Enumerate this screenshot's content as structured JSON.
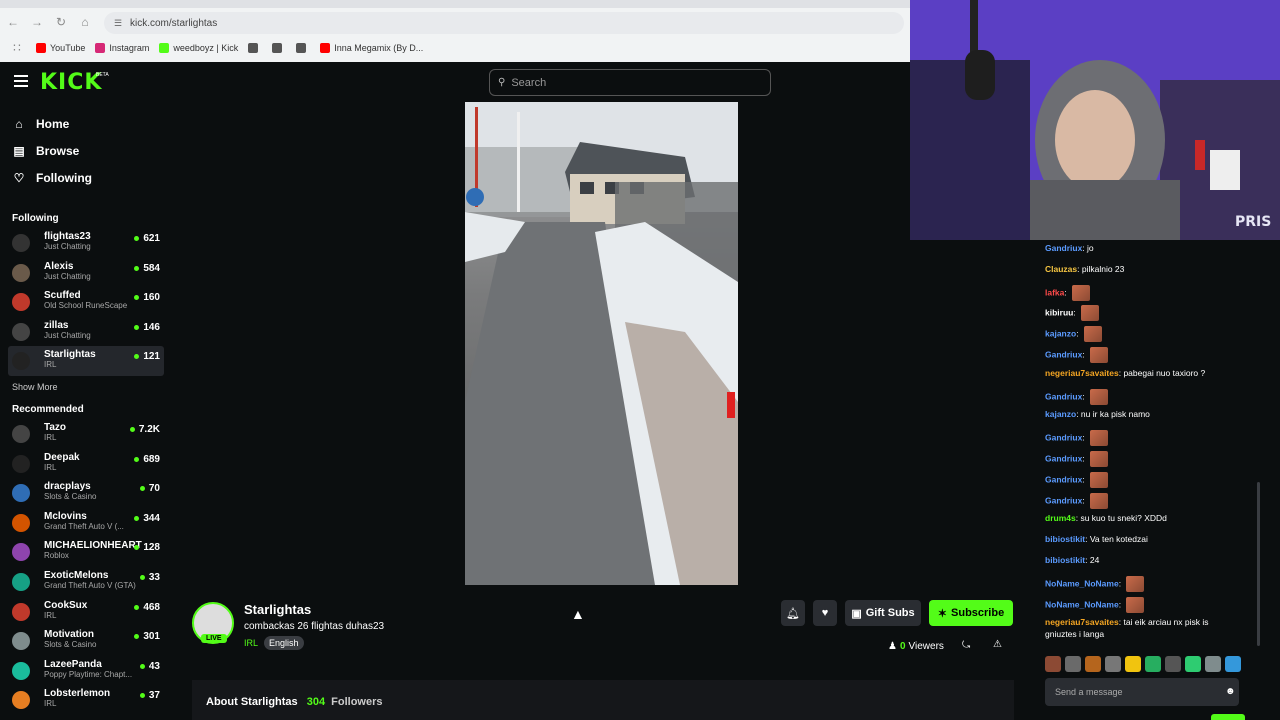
{
  "browser": {
    "url": "kick.com/starlightas",
    "bookmarks": [
      {
        "label": "YouTube",
        "color": "#ff0000"
      },
      {
        "label": "Instagram",
        "color": "#d62976"
      },
      {
        "label": "weedboyz | Kick",
        "color": "#53fc18"
      },
      {
        "label": "",
        "color": "#555555"
      },
      {
        "label": "",
        "color": "#555555"
      },
      {
        "label": "",
        "color": "#555555"
      },
      {
        "label": "Inna Megamix (By D...",
        "color": "#ff0000"
      }
    ]
  },
  "header": {
    "logo": "KICK",
    "logo_badge": "BETA",
    "search_placeholder": "Search"
  },
  "sidebar": {
    "nav": [
      {
        "label": "Home",
        "icon": "home-icon"
      },
      {
        "label": "Browse",
        "icon": "browse-icon"
      },
      {
        "label": "Following",
        "icon": "heart-icon"
      }
    ],
    "following_title": "Following",
    "following": [
      {
        "name": "flightas23",
        "category": "Just Chatting",
        "viewers": "621"
      },
      {
        "name": "Alexis",
        "category": "Just Chatting",
        "viewers": "584"
      },
      {
        "name": "Scuffed",
        "category": "Old School RuneScape",
        "viewers": "160"
      },
      {
        "name": "zillas",
        "category": "Just Chatting",
        "viewers": "146"
      },
      {
        "name": "Starlightas",
        "category": "IRL",
        "viewers": "121"
      }
    ],
    "show_more": "Show More",
    "recommended_title": "Recommended",
    "recommended": [
      {
        "name": "Tazo",
        "category": "IRL",
        "viewers": "7.2K"
      },
      {
        "name": "Deepak",
        "category": "IRL",
        "viewers": "689"
      },
      {
        "name": "dracplays",
        "category": "Slots & Casino",
        "viewers": "70"
      },
      {
        "name": "Mclovins",
        "category": "Grand Theft Auto V (...",
        "viewers": "344"
      },
      {
        "name": "MICHAELIONHEART",
        "category": "Roblox",
        "viewers": "128"
      },
      {
        "name": "ExoticMelons",
        "category": "Grand Theft Auto V (GTA)",
        "viewers": "33"
      },
      {
        "name": "CookSux",
        "category": "IRL",
        "viewers": "468"
      },
      {
        "name": "Motivation",
        "category": "Slots & Casino",
        "viewers": "301"
      },
      {
        "name": "LazeePanda",
        "category": "Poppy Playtime: Chapt...",
        "viewers": "43"
      },
      {
        "name": "Lobsterlemon",
        "category": "IRL",
        "viewers": "37"
      }
    ]
  },
  "stream": {
    "live_badge": "LIVE",
    "streamer": "Starlightas",
    "title": "combackas 26 flightas duhas23",
    "category": "IRL",
    "language": "English",
    "gift_label": "Gift Subs",
    "subscribe_label": "Subscribe",
    "viewers": "0",
    "viewers_label": "Viewers",
    "about_label": "About Starlightas",
    "followers": "304",
    "followers_label": "Followers"
  },
  "webcam": {
    "overlay_text": "PRIS"
  },
  "chat": {
    "messages": [
      {
        "user": "Gandriux",
        "color": "#5b9bff",
        "text": "jo",
        "emote": false
      },
      {
        "user": "Clauzas",
        "color": "#f5c542",
        "text": "pilkalnio 23",
        "emote": false
      },
      {
        "user": "lafka",
        "color": "#ff4a4a",
        "text": "",
        "emote": true
      },
      {
        "user": "kibiruu",
        "color": "#ffffff",
        "text": "",
        "emote": true
      },
      {
        "user": "kajanzo",
        "color": "#5b9bff",
        "text": "",
        "emote": true
      },
      {
        "user": "Gandriux",
        "color": "#5b9bff",
        "text": "",
        "emote": true
      },
      {
        "user": "negeriau7savaites",
        "color": "#f5a623",
        "text": "pabegai nuo taxioro ?",
        "emote": false
      },
      {
        "user": "Gandriux",
        "color": "#5b9bff",
        "text": "",
        "emote": true
      },
      {
        "user": "kajanzo",
        "color": "#5b9bff",
        "text": "nu ir ka pisk namo",
        "emote": false
      },
      {
        "user": "Gandriux",
        "color": "#5b9bff",
        "text": "",
        "emote": true
      },
      {
        "user": "Gandriux",
        "color": "#5b9bff",
        "text": "",
        "emote": true
      },
      {
        "user": "Gandriux",
        "color": "#5b9bff",
        "text": "",
        "emote": true
      },
      {
        "user": "Gandriux",
        "color": "#5b9bff",
        "text": "",
        "emote": true
      },
      {
        "user": "drum4s",
        "color": "#53fc18",
        "text": "su kuo tu sneki? XDDd",
        "emote": false
      },
      {
        "user": "bibiostikit",
        "color": "#5b9bff",
        "text": "Va ten kotedzai",
        "emote": false
      },
      {
        "user": "bibiostikit",
        "color": "#5b9bff",
        "text": "24",
        "emote": false
      },
      {
        "user": "NoName_NoName",
        "color": "#5b9bff",
        "text": "",
        "emote": true
      },
      {
        "user": "NoName_NoName",
        "color": "#5b9bff",
        "text": "",
        "emote": true
      },
      {
        "user": "negeriau7savaites",
        "color": "#f5a623",
        "text": "tai eik arciau nx pisk is",
        "emote": false
      },
      {
        "user": "",
        "color": "#ffffff",
        "text": "gniuztes i langa",
        "emote": false
      }
    ],
    "input_placeholder": "Send a message"
  },
  "colors": {
    "accent": "#53fc18",
    "background": "#0b0e0f"
  }
}
